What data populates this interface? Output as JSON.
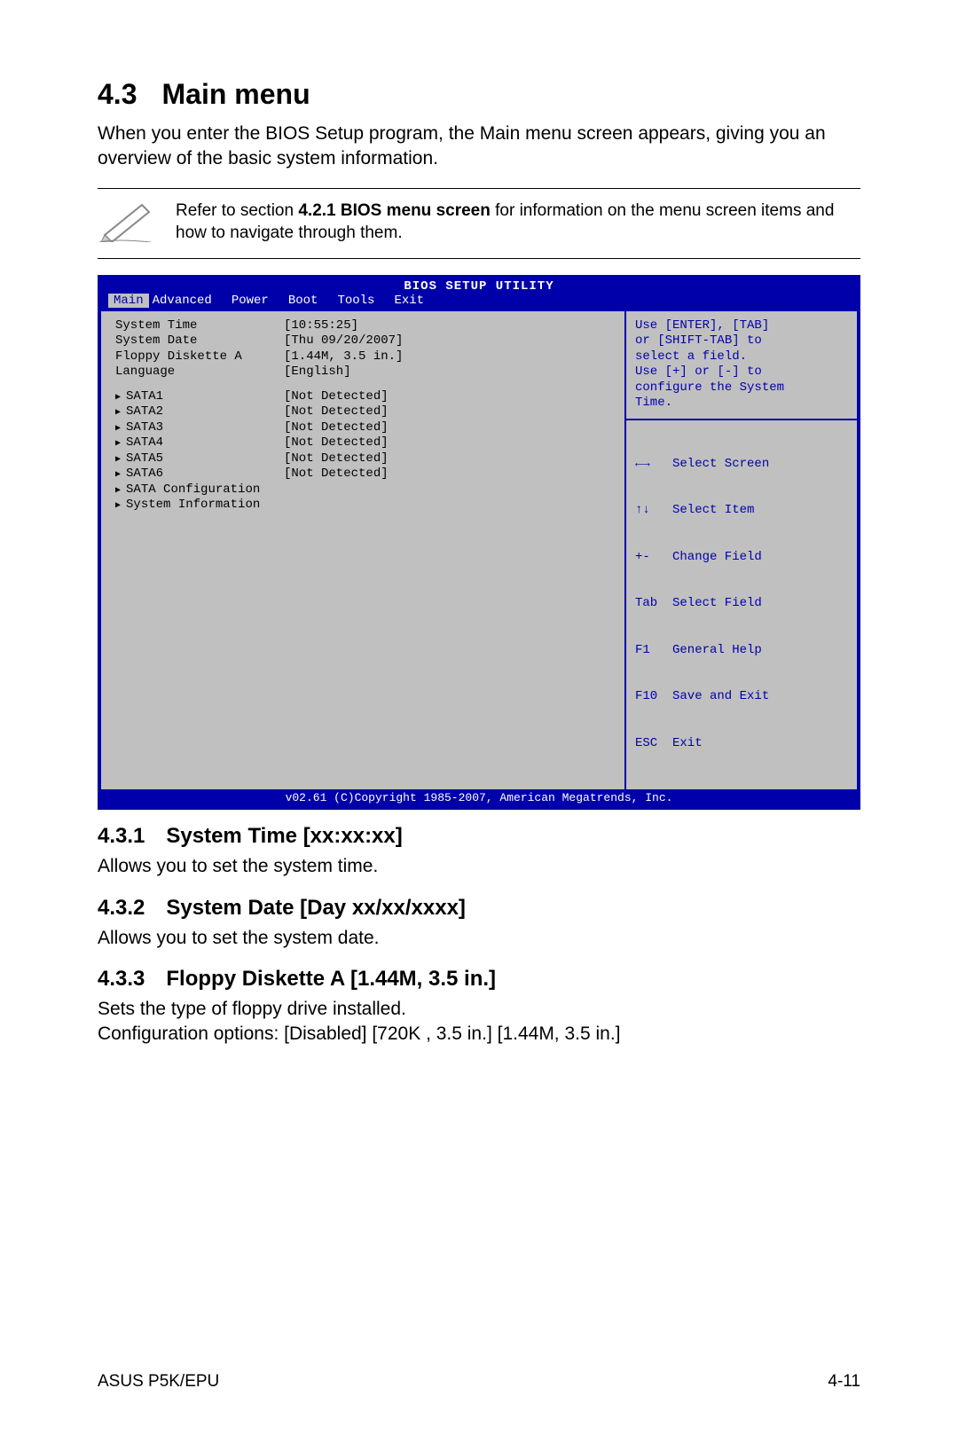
{
  "section": {
    "number": "4.3",
    "title": "Main menu"
  },
  "intro": "When you enter the BIOS Setup program, the Main menu screen appears, giving you an overview of the basic system information.",
  "note": {
    "pre": "Refer to section ",
    "bold": "4.2.1  BIOS menu screen",
    "post": " for information on the menu screen items and how to navigate through them."
  },
  "bios": {
    "title": "BIOS SETUP UTILITY",
    "tabs": [
      "Main",
      "Advanced",
      "Power",
      "Boot",
      "Tools",
      "Exit"
    ],
    "fields": [
      {
        "label": "System Time",
        "value": "[10:55:25]"
      },
      {
        "label": "System Date",
        "value": "[Thu 09/20/2007]"
      },
      {
        "label": "Floppy Diskette A",
        "value": "[1.44M, 3.5 in.]"
      },
      {
        "label": "Language",
        "value": "[English]"
      }
    ],
    "sata": [
      {
        "label": "SATA1",
        "value": "[Not Detected]"
      },
      {
        "label": "SATA2",
        "value": "[Not Detected]"
      },
      {
        "label": "SATA3",
        "value": "[Not Detected]"
      },
      {
        "label": "SATA4",
        "value": "[Not Detected]"
      },
      {
        "label": "SATA5",
        "value": "[Not Detected]"
      },
      {
        "label": "SATA6",
        "value": "[Not Detected]"
      }
    ],
    "extra": [
      "SATA Configuration",
      "System Information"
    ],
    "help": [
      "Use [ENTER], [TAB]",
      "or [SHIFT-TAB] to",
      "select a field.",
      "",
      "Use [+] or [-] to",
      "configure the System",
      "Time."
    ],
    "legend": [
      {
        "sym": "←→",
        "text": "Select Screen"
      },
      {
        "sym": "↑↓",
        "text": "Select Item"
      },
      {
        "sym": "+-",
        "text": "Change Field"
      },
      {
        "sym": "Tab",
        "text": "Select Field"
      },
      {
        "sym": "F1",
        "text": "General Help"
      },
      {
        "sym": "F10",
        "text": "Save and Exit"
      },
      {
        "sym": "ESC",
        "text": "Exit"
      }
    ],
    "footer": "v02.61 (C)Copyright 1985-2007, American Megatrends, Inc."
  },
  "subsections": [
    {
      "num": "4.3.1",
      "title": "System Time [xx:xx:xx]",
      "body": "Allows you to set the system time."
    },
    {
      "num": "4.3.2",
      "title": "System Date [Day xx/xx/xxxx]",
      "body": "Allows you to set the system date."
    },
    {
      "num": "4.3.3",
      "title": "Floppy Diskette A [1.44M, 3.5 in.]",
      "body": "Sets the type of floppy drive installed.\nConfiguration options: [Disabled] [720K , 3.5 in.] [1.44M, 3.5 in.]"
    }
  ],
  "footer": {
    "left": "ASUS P5K/EPU",
    "right": "4-11"
  }
}
